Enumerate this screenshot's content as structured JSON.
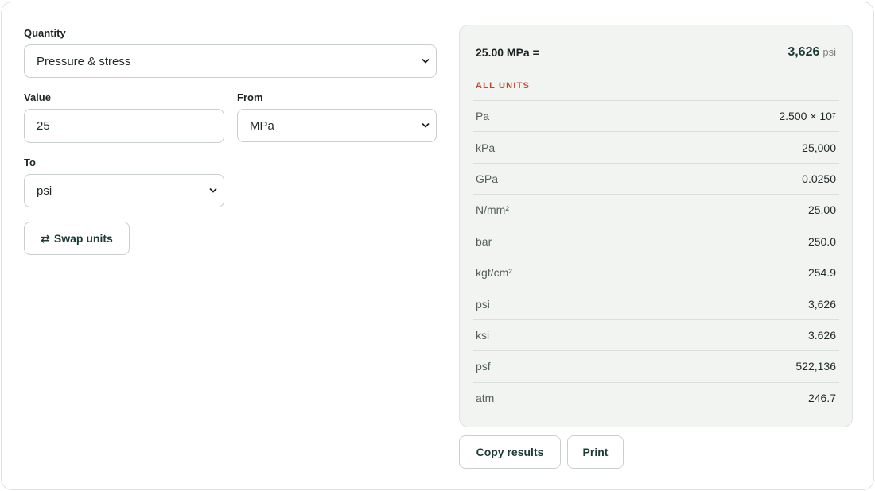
{
  "form": {
    "quantity_label": "Quantity",
    "quantity_value": "Pressure & stress",
    "value_label": "Value",
    "value_input": "25",
    "from_label": "From",
    "from_value": "MPa",
    "to_label": "To",
    "to_value": "psi",
    "swap_label": "Swap units",
    "swap_icon": "⇄"
  },
  "result": {
    "input_text": "25.00 MPa =",
    "output_value": "3,626",
    "output_unit": "psi",
    "section_title": "ALL UNITS",
    "rows": [
      {
        "unit": "Pa",
        "value": "2.500 × 10⁷"
      },
      {
        "unit": "kPa",
        "value": "25,000"
      },
      {
        "unit": "GPa",
        "value": "0.0250"
      },
      {
        "unit": "N/mm²",
        "value": "25.00"
      },
      {
        "unit": "bar",
        "value": "250.0"
      },
      {
        "unit": "kgf/cm²",
        "value": "254.9"
      },
      {
        "unit": "psi",
        "value": "3,626"
      },
      {
        "unit": "ksi",
        "value": "3.626"
      },
      {
        "unit": "psf",
        "value": "522,136"
      },
      {
        "unit": "atm",
        "value": "246.7"
      }
    ]
  },
  "actions": {
    "copy_label": "Copy results",
    "print_label": "Print"
  },
  "colors": {
    "accent": "#1c3a36",
    "section_title": "#c0492b",
    "panel_bg": "#f2f4f2"
  }
}
